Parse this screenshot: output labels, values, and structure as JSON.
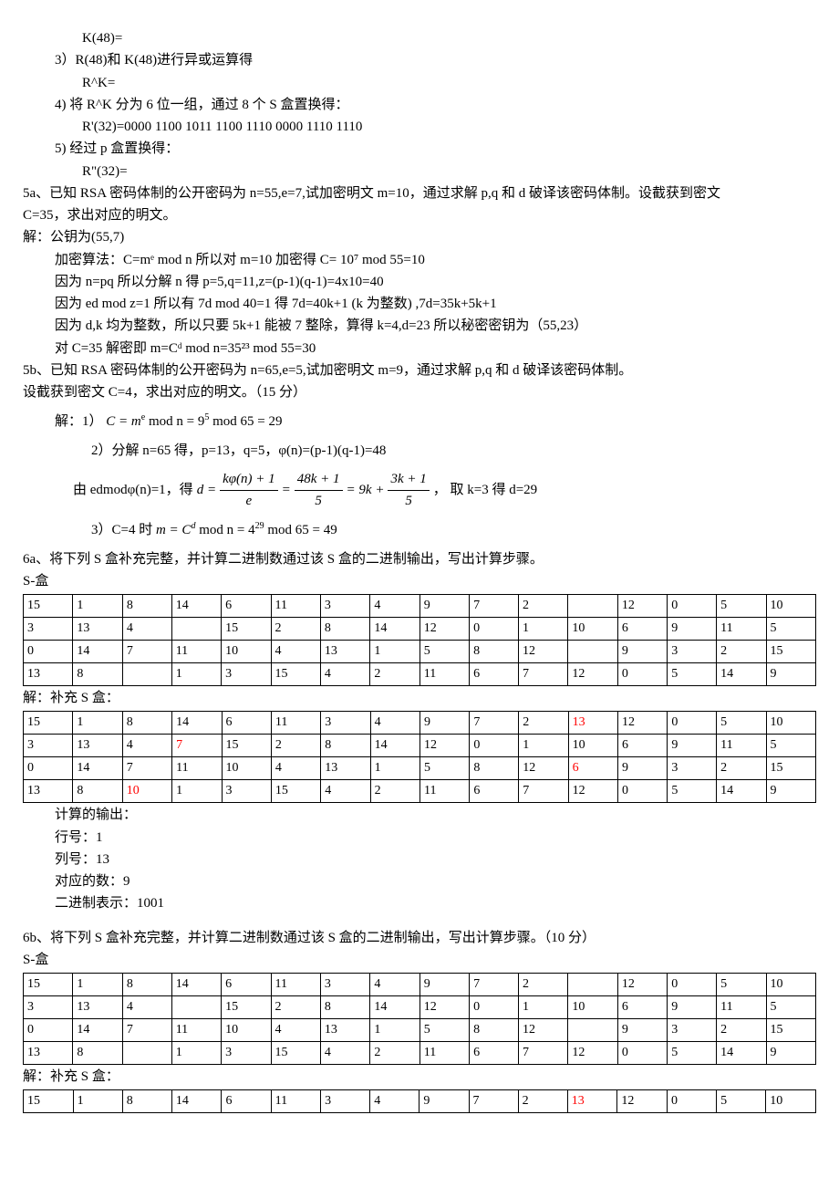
{
  "lines": {
    "k48": "K(48)=",
    "l3": "3）R(48)和 K(48)进行异或运算得",
    "rk": "R^K=",
    "l4": "4)  将 R^K 分为 6 位一组，通过 8 个 S 盒置换得：",
    "rprime": "R'(32)=0000 1100 1011 1100 1110 0000 1110 1110",
    "l5": "5)  经过 p 盒置换得：",
    "rpp": "R\"(32)=",
    "p5a_1": "5a、已知 RSA 密码体制的公开密码为 n=55,e=7,试加密明文 m=10，通过求解 p,q 和 d 破译该密码体制。设截获到密文",
    "p5a_2": "C=35，求出对应的明文。",
    "s5a_ans": "解：公钥为(55,7)",
    "s5a_l1": "加密算法：C=mᵉ mod n      所以对 m=10  加密得  C= 10⁷ mod 55=10",
    "s5a_l2": "因为  n=pq  所以分解 n  得  p=5,q=11,z=(p-1)(q-1)=4x10=40",
    "s5a_l3": "因为 ed mod z=1  所以有  7d mod 40=1 得 7d=40k+1 (k 为整数) ,7d=35k+5k+1",
    "s5a_l4": "因为 d,k  均为整数，所以只要 5k+1 能被 7 整除，算得 k=4,d=23 所以秘密密钥为（55,23）",
    "s5a_l5": "对 C=35 解密即 m=Cᵈ mod n=35²³ mod 55=30",
    "p5b_1": "5b、已知 RSA 密码体制的公开密码为 n=65,e=5,试加密明文 m=9，通过求解 p,q 和 d 破译该密码体制。",
    "p5b_2": "设截获到密文 C=4，求出对应的明文。（15 分）",
    "s5b_pre": "解：1）",
    "s5b_eq1_a": "C = m",
    "s5b_eq1_b": " mod n = 9",
    "s5b_eq1_c": " mod 65 = 29",
    "s5b_l2": "2）分解 n=65 得，p=13，q=5，φ(n)=(p-1)(q-1)=48",
    "s5b_l3_pre": "由 edmodφ(n)=1，得",
    "s5b_l3_post": "，   取 k=3 得 d=29",
    "s5b_eq2_d": "d =",
    "frac1_top": "kφ(n) + 1",
    "frac1_bot": "e",
    "frac2_top": "48k + 1",
    "frac2_bot": "5",
    "nine_k": "= 9k +",
    "frac3_top": "3k + 1",
    "frac3_bot": "5",
    "s5b_l4_pre": "3）C=4 时 ",
    "s5b_eq3_a": "m = C",
    "s5b_eq3_b": " mod n = 4",
    "s5b_eq3_c": " mod 65 = 49",
    "p6a": "6a、将下列 S 盒补充完整，并计算二进制数通过该 S 盒的二进制输出，写出计算步骤。",
    "sbox_label": "S-盒",
    "ans_fill": "解：补充 S 盒：",
    "calc_out": "计算的输出：",
    "row_num": "行号：1",
    "col_num": "列号：13",
    "corr_num": "对应的数：9",
    "bin_rep": "二进制表示：1001",
    "p6b": "6b、将下列 S 盒补充完整，并计算二进制数通过该 S 盒的二进制输出，写出计算步骤。（10 分）"
  },
  "tables": {
    "sbox1": [
      [
        "15",
        "1",
        "8",
        "14",
        "6",
        "11",
        "3",
        "4",
        "9",
        "7",
        "2",
        "",
        "12",
        "0",
        "5",
        "10"
      ],
      [
        "3",
        "13",
        "4",
        "",
        "15",
        "2",
        "8",
        "14",
        "12",
        "0",
        "1",
        "10",
        "6",
        "9",
        "11",
        "5"
      ],
      [
        "0",
        "14",
        "7",
        "11",
        "10",
        "4",
        "13",
        "1",
        "5",
        "8",
        "12",
        "",
        "9",
        "3",
        "2",
        "15"
      ],
      [
        "13",
        "8",
        "",
        "1",
        "3",
        "15",
        "4",
        "2",
        "11",
        "6",
        "7",
        "12",
        "0",
        "5",
        "14",
        "9"
      ]
    ],
    "sbox1_fill": [
      [
        "15",
        "1",
        "8",
        "14",
        "6",
        "11",
        "3",
        "4",
        "9",
        "7",
        "2",
        "13",
        "12",
        "0",
        "5",
        "10"
      ],
      [
        "3",
        "13",
        "4",
        "7",
        "15",
        "2",
        "8",
        "14",
        "12",
        "0",
        "1",
        "10",
        "6",
        "9",
        "11",
        "5"
      ],
      [
        "0",
        "14",
        "7",
        "11",
        "10",
        "4",
        "13",
        "1",
        "5",
        "8",
        "12",
        "6",
        "9",
        "3",
        "2",
        "15"
      ],
      [
        "13",
        "8",
        "10",
        "1",
        "3",
        "15",
        "4",
        "2",
        "11",
        "6",
        "7",
        "12",
        "0",
        "5",
        "14",
        "9"
      ]
    ],
    "sbox1_fill_red": [
      [
        "",
        "",
        "",
        "",
        "",
        "",
        "",
        "",
        "",
        "",
        "",
        "1",
        "",
        "",
        "",
        ""
      ],
      [
        "",
        "",
        "",
        "1",
        "",
        "",
        "",
        "",
        "",
        "",
        "",
        "",
        "",
        "",
        "",
        ""
      ],
      [
        "",
        "",
        "",
        "",
        "",
        "",
        "",
        "",
        "",
        "",
        "",
        "1",
        "",
        "",
        "",
        ""
      ],
      [
        "",
        "",
        "1",
        "",
        "",
        "",
        "",
        "",
        "",
        "",
        "",
        "",
        "",
        "",
        "",
        ""
      ]
    ],
    "sbox2": [
      [
        "15",
        "1",
        "8",
        "14",
        "6",
        "11",
        "3",
        "4",
        "9",
        "7",
        "2",
        "",
        "12",
        "0",
        "5",
        "10"
      ],
      [
        "3",
        "13",
        "4",
        "",
        "15",
        "2",
        "8",
        "14",
        "12",
        "0",
        "1",
        "10",
        "6",
        "9",
        "11",
        "5"
      ],
      [
        "0",
        "14",
        "7",
        "11",
        "10",
        "4",
        "13",
        "1",
        "5",
        "8",
        "12",
        "",
        "9",
        "3",
        "2",
        "15"
      ],
      [
        "13",
        "8",
        "",
        "1",
        "3",
        "15",
        "4",
        "2",
        "11",
        "6",
        "7",
        "12",
        "0",
        "5",
        "14",
        "9"
      ]
    ],
    "sbox2_fill": [
      [
        "15",
        "1",
        "8",
        "14",
        "6",
        "11",
        "3",
        "4",
        "9",
        "7",
        "2",
        "13",
        "12",
        "0",
        "5",
        "10"
      ]
    ],
    "sbox2_fill_red": [
      [
        "",
        "",
        "",
        "",
        "",
        "",
        "",
        "",
        "",
        "",
        "",
        "1",
        "",
        "",
        "",
        ""
      ]
    ]
  }
}
